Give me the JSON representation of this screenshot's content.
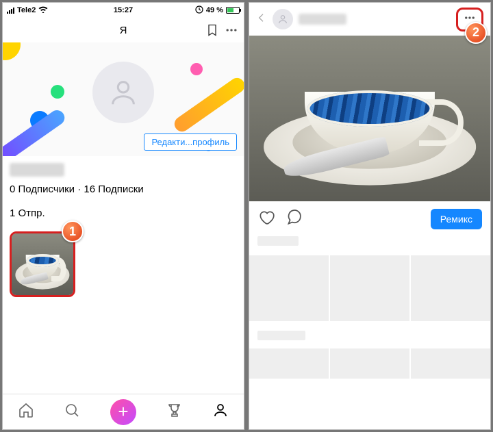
{
  "status": {
    "carrier": "Tele2",
    "time": "15:27",
    "battery_text": "49 %",
    "battery_level": 49
  },
  "left": {
    "header_title": "Я",
    "edit_profile": "Редакти...профиль",
    "followers_count": 0,
    "followers_label": "Подписчики",
    "following_count": 16,
    "following_label": "Подписки",
    "stats_line": "0 Подписчики · 16 Подписки",
    "posts_count": 1,
    "posts_label": "Отпр.",
    "posts_line": "1 Отпр."
  },
  "callouts": {
    "one": "1",
    "two": "2"
  },
  "right": {
    "remix_label": "Ремикс"
  }
}
